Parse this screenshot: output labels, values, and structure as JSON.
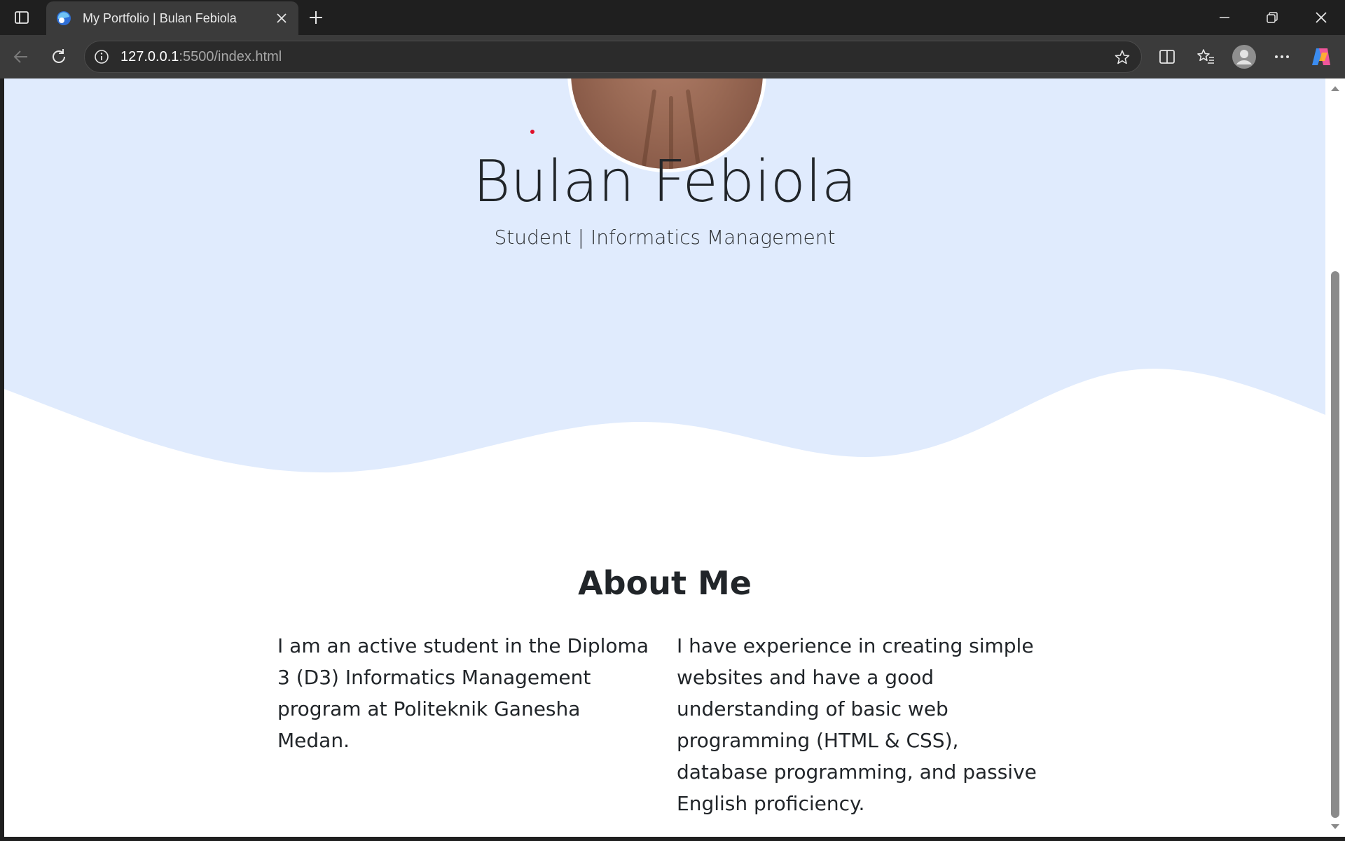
{
  "browser": {
    "tab_title": "My Portfolio | Bulan Febiola",
    "url_host": "127.0.0.1",
    "url_rest": ":5500/index.html",
    "icons": {
      "tab_actions": "tab-actions-icon",
      "favicon": "edge-favicon-icon",
      "close_tab": "close-icon",
      "new_tab": "plus-icon",
      "minimize": "minimize-icon",
      "restore": "restore-icon",
      "close_window": "close-icon",
      "back": "back-arrow-icon",
      "refresh": "refresh-icon",
      "site_info": "info-icon",
      "favorite": "star-icon",
      "split_screen": "split-screen-icon",
      "favorites": "favorites-icon",
      "profile": "profile-icon",
      "more": "more-icon",
      "copilot": "copilot-icon"
    }
  },
  "hero": {
    "name": "Bulan Febiola",
    "subtitle": "Student | Informatics Management",
    "background_color": "#e0ebfd"
  },
  "about": {
    "title": "About Me",
    "left_text": "I am an active student in the Diploma 3 (D3) Informatics Management program at Politeknik Ganesha Medan.",
    "right_text": "I have experience in creating simple websites and have a good understanding of basic web programming (HTML & CSS), database programming, and passive English proficiency."
  }
}
